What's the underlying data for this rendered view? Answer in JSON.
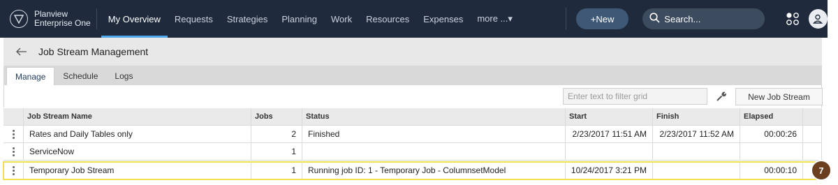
{
  "app": {
    "logo_line1": "Planview",
    "logo_line2": "Enterprise One",
    "nav": [
      {
        "label": "My Overview",
        "active": true
      },
      {
        "label": "Requests"
      },
      {
        "label": "Strategies"
      },
      {
        "label": "Planning"
      },
      {
        "label": "Work"
      },
      {
        "label": "Resources"
      },
      {
        "label": "Expenses"
      },
      {
        "label": "more ...▾"
      }
    ],
    "new_label": "+New",
    "search_placeholder": "Search..."
  },
  "page": {
    "title": "Job Stream Management",
    "tabs": [
      {
        "label": "Manage",
        "active": true
      },
      {
        "label": "Schedule"
      },
      {
        "label": "Logs"
      }
    ]
  },
  "toolbar": {
    "filter_placeholder": "Enter text to filter grid",
    "new_job_stream_label": "New Job Stream"
  },
  "grid": {
    "columns": [
      "Job Stream Name",
      "Jobs",
      "Status",
      "Start",
      "Finish",
      "Elapsed"
    ],
    "rows": [
      {
        "name": "Rates and Daily Tables only",
        "jobs": "2",
        "status": "Finished",
        "start": "2/23/2017 11:51 AM",
        "finish": "2/23/2017 11:52 AM",
        "elapsed": "00:00:26"
      },
      {
        "name": "ServiceNow",
        "jobs": "1",
        "status": "",
        "start": "",
        "finish": "",
        "elapsed": ""
      },
      {
        "name": "Temporary Job Stream",
        "jobs": "1",
        "status": "Running job ID: 1 - Temporary Job - ColumnsetModel",
        "start": "10/24/2017 3:21 PM",
        "finish": "",
        "elapsed": "00:00:10"
      }
    ]
  },
  "callout": {
    "number": "7",
    "color": "#6b3e1f"
  },
  "colors": {
    "nav_bg": "#1f2b3d",
    "accent": "#4ea7e8",
    "highlight": "#f4e04d"
  },
  "icons": [
    "logo-triangle-icon",
    "search-icon",
    "apps-icon",
    "user-icon",
    "back-arrow-icon",
    "wrench-icon",
    "row-menu-icon"
  ]
}
